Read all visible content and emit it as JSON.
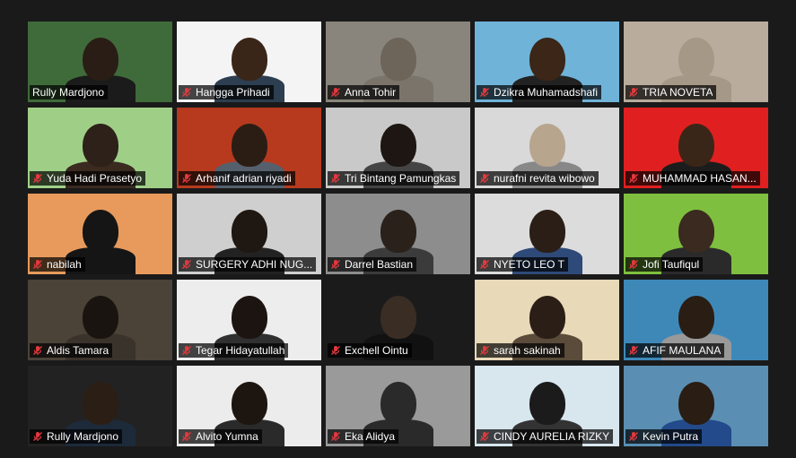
{
  "participants": [
    {
      "name": "Rully Mardjono",
      "muted": false,
      "active": true,
      "bg": "#3f6b3a",
      "head": "#2a1d16",
      "shirt": "#1b1b1b"
    },
    {
      "name": "Hangga Prihadi",
      "muted": true,
      "bg": "#f4f4f4",
      "head": "#3a2618",
      "shirt": "#2c3e50"
    },
    {
      "name": "Anna Tohir",
      "muted": true,
      "bg": "#8a857c",
      "head": "#6d645a",
      "shirt": "#7a746b"
    },
    {
      "name": "Dzikra Muhamadshafi",
      "muted": true,
      "bg": "#6fb3d9",
      "head": "#3b2617",
      "shirt": "#222222"
    },
    {
      "name": "TRIA NOVETA",
      "muted": true,
      "bg": "#b9ac9c",
      "head": "#a69886",
      "shirt": "#a69886"
    },
    {
      "name": "Yuda Hadi Prasetyo",
      "muted": true,
      "bg": "#9fcf87",
      "head": "#2d2119",
      "shirt": "#3a2a20"
    },
    {
      "name": "Arhanif adrian riyadi",
      "muted": true,
      "bg": "#b73a1f",
      "head": "#2b1d14",
      "shirt": "#55606c"
    },
    {
      "name": "Tri Bintang Pamungkas",
      "muted": true,
      "bg": "#c9c9c9",
      "head": "#1d1612",
      "shirt": "#444444"
    },
    {
      "name": "nurafni revita wibowo",
      "muted": true,
      "bg": "#d9d9d9",
      "head": "#b8a58e",
      "shirt": "#888888"
    },
    {
      "name": "MUHAMMAD HASAN...",
      "muted": true,
      "bg": "#e02020",
      "head": "#3a2618",
      "shirt": "#1c1c1c"
    },
    {
      "name": "nabilah",
      "muted": true,
      "bg": "#e79a5c",
      "head": "#151515",
      "shirt": "#151515"
    },
    {
      "name": "SURGERY ADHI NUG...",
      "muted": true,
      "bg": "#cfcfcf",
      "head": "#1f1712",
      "shirt": "#222222"
    },
    {
      "name": "Darrel Bastian",
      "muted": true,
      "bg": "#8d8d8d",
      "head": "#2a211b",
      "shirt": "#3b3b3b"
    },
    {
      "name": "NYETO LEO T",
      "muted": true,
      "bg": "#dcdcdc",
      "head": "#2a1e16",
      "shirt": "#2e4a78"
    },
    {
      "name": "Jofi Taufiqul",
      "muted": true,
      "bg": "#7fbf3f",
      "head": "#3a2a20",
      "shirt": "#2a2a2a"
    },
    {
      "name": "Aldis Tamara",
      "muted": true,
      "bg": "#4b4238",
      "head": "#1a1410",
      "shirt": "#3a332b"
    },
    {
      "name": "Tegar Hidayatullah",
      "muted": true,
      "bg": "#ededed",
      "head": "#1c1410",
      "shirt": "#303030"
    },
    {
      "name": "Exchell Ointu",
      "muted": true,
      "bg": "#1b1b1b",
      "head": "#3a2d24",
      "shirt": "#111111"
    },
    {
      "name": "sarah sakinah",
      "muted": true,
      "bg": "#e8d9b8",
      "head": "#2a1e16",
      "shirt": "#5a4b3a"
    },
    {
      "name": "AFIF MAULANA",
      "muted": true,
      "bg": "#3e88b8",
      "head": "#2a1d14",
      "shirt": "#999999"
    },
    {
      "name": "Rully Mardjono",
      "muted": true,
      "bg": "#222222",
      "head": "#2b1e15",
      "shirt": "#1d2a3a"
    },
    {
      "name": "Alvito Yumna",
      "muted": true,
      "bg": "#ececec",
      "head": "#1d1510",
      "shirt": "#2a2a2a"
    },
    {
      "name": "Eka Alidya",
      "muted": true,
      "bg": "#9a9a9a",
      "head": "#2a2a2a",
      "shirt": "#2a2a2a"
    },
    {
      "name": "CINDY AURELIA RIZKY",
      "muted": true,
      "bg": "#d8e6ee",
      "head": "#1b1b1b",
      "shirt": "#333333"
    },
    {
      "name": "Kevin Putra",
      "muted": true,
      "bg": "#5a8fb3",
      "head": "#2a1d14",
      "shirt": "#234a8a"
    }
  ],
  "colors": {
    "background": "#1a1a1a",
    "active_border": "#e8e06a",
    "mute_red": "#e0383e"
  },
  "icons": {
    "muted": "microphone-muted-icon"
  }
}
